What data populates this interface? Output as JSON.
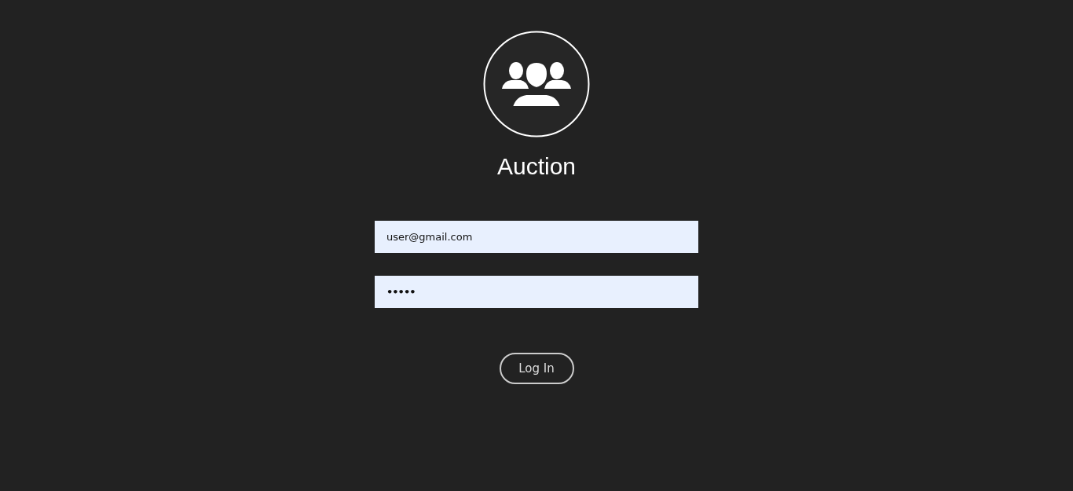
{
  "title": "Auction",
  "fields": [
    {
      "kind": "email",
      "value": "user@gmail.com"
    },
    {
      "kind": "password",
      "value": "•••••"
    }
  ],
  "button": "Log In"
}
